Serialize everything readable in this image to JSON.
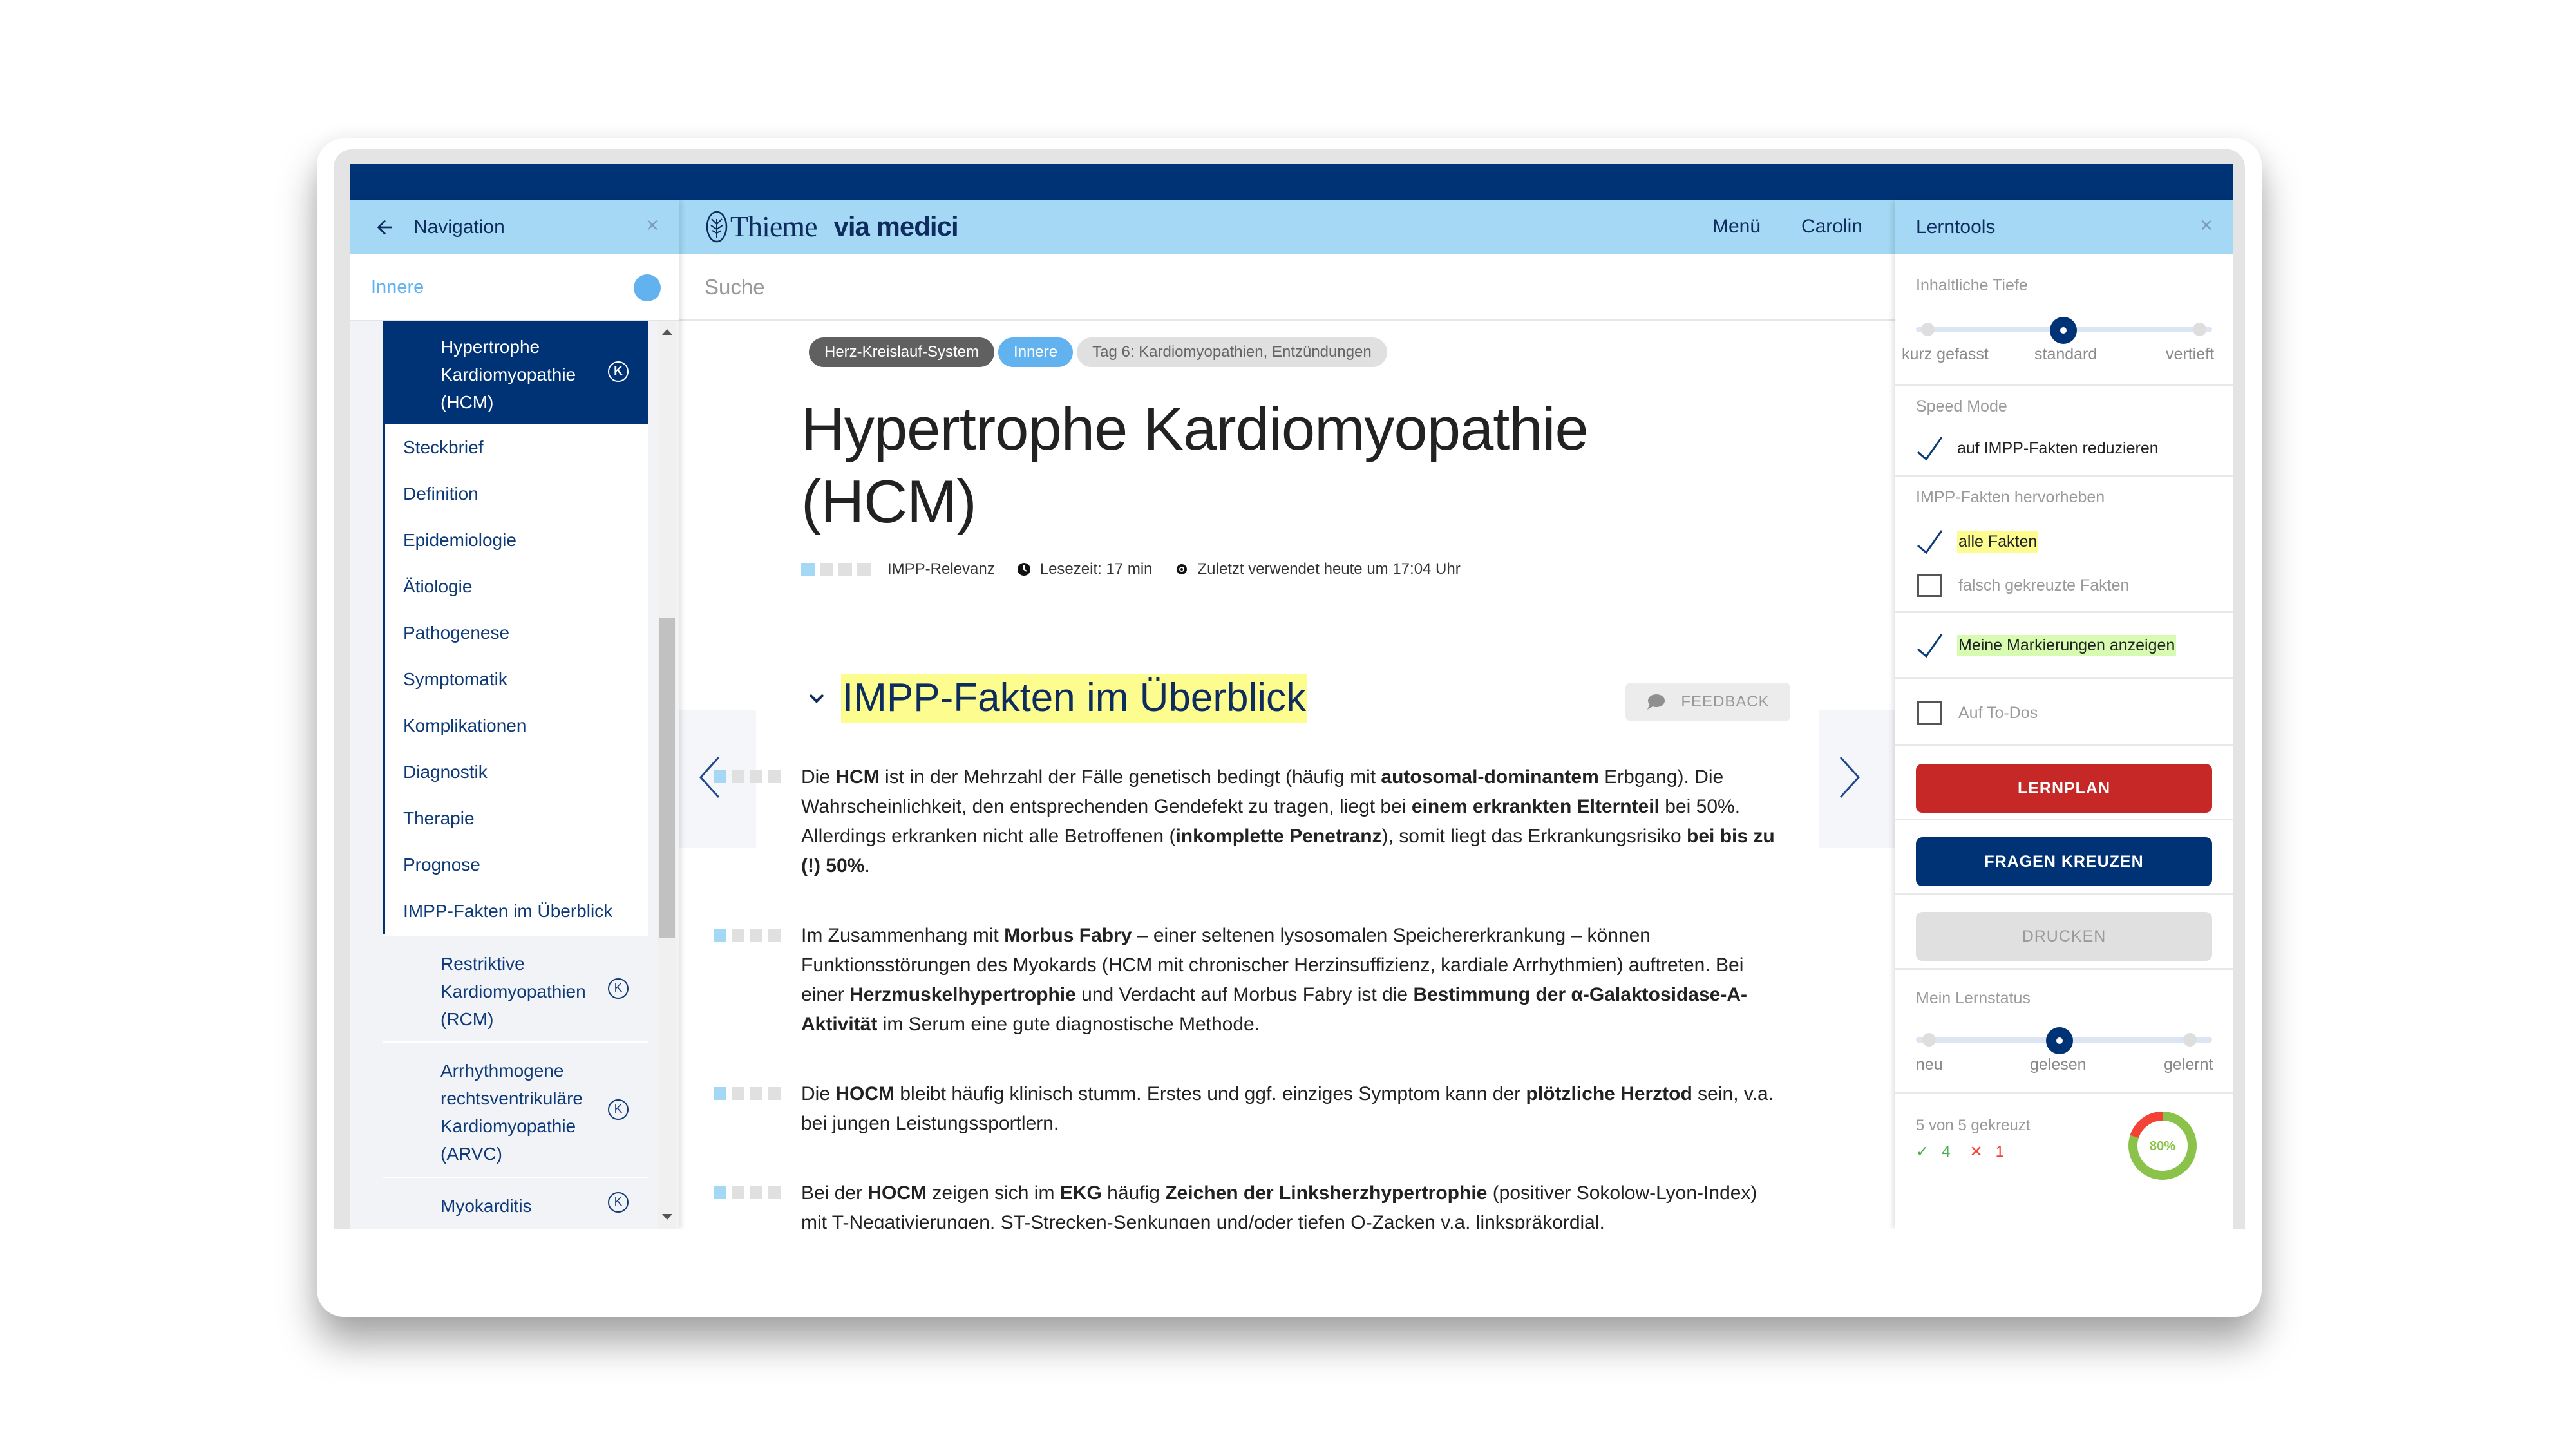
{
  "navigation": {
    "title": "Navigation",
    "filter_label": "Innere",
    "active_item": "Hypertrophe Kardiomyopathie (HCM)",
    "active_badge": "K",
    "sub_items": [
      "Steckbrief",
      "Definition",
      "Epidemiologie",
      "Ätiologie",
      "Pathogenese",
      "Symptomatik",
      "Komplikationen",
      "Diagnostik",
      "Therapie",
      "Prognose",
      "IMPP-Fakten im Überblick"
    ],
    "siblings": [
      {
        "label": "Restriktive Kardiomyopathien (RCM)",
        "badge": "K"
      },
      {
        "label": "Arrhythmogene rechtsventrikuläre Kardiomyopathie (ARVC)",
        "badge": "K"
      },
      {
        "label": "Myokarditis",
        "badge": "K"
      }
    ]
  },
  "header": {
    "brand_thieme": "Thieme",
    "brand_via": "via medici",
    "menu_label": "Menü",
    "user_label": "Carolin",
    "search_placeholder": "Suche"
  },
  "article": {
    "tags": [
      "Herz-Kreislauf-System",
      "Innere",
      "Tag 6: Kardiomyopathien, Entzündungen"
    ],
    "title": "Hypertrophe Kardiomyopathie (HCM)",
    "impp_relevance_label": "IMPP-Relevanz",
    "impp_relevance_level": "1 of 4",
    "reading_time": "Lesezeit: 17 min",
    "last_used": "Zuletzt verwendet heute um 17:04 Uhr",
    "section_title": "IMPP-Fakten im Überblick",
    "feedback_label": "FEEDBACK",
    "facts": [
      {
        "relevance": "1 of 4",
        "segments": [
          {
            "t": "Die "
          },
          {
            "t": "HCM",
            "b": true
          },
          {
            "t": " ist in der Mehrzahl der Fälle genetisch bedingt (häufig mit "
          },
          {
            "t": "autosomal-dominantem",
            "b": true
          },
          {
            "t": " Erbgang). Die Wahrscheinlichkeit, den entsprechenden Gendefekt zu tragen, liegt bei "
          },
          {
            "t": "einem erkrankten Elternteil",
            "b": true
          },
          {
            "t": " bei 50%. Allerdings erkranken nicht alle Betroffenen ("
          },
          {
            "t": "inkomplette Penetranz",
            "b": true
          },
          {
            "t": "), somit liegt das Erkrankungsrisiko "
          },
          {
            "t": "bei bis zu (!) 50%",
            "b": true
          },
          {
            "t": "."
          }
        ]
      },
      {
        "relevance": "1 of 4",
        "segments": [
          {
            "t": "Im Zusammenhang mit "
          },
          {
            "t": "Morbus Fabry",
            "b": true
          },
          {
            "t": " – einer seltenen lysosomalen Speichererkrankung – können Funktionsstörungen des Myokards (HCM mit chronischer Herzinsuffizienz, kardiale Arrhythmien) auftreten. Bei einer "
          },
          {
            "t": "Herzmuskelhypertrophie",
            "b": true
          },
          {
            "t": " und Verdacht auf Morbus Fabry ist die "
          },
          {
            "t": "Bestimmung der α-Galaktosidase-A-Aktivität",
            "b": true
          },
          {
            "t": " im Serum eine gute diagnostische Methode."
          }
        ]
      },
      {
        "relevance": "1 of 4",
        "segments": [
          {
            "t": "Die "
          },
          {
            "t": "HOCM",
            "b": true
          },
          {
            "t": " bleibt häufig klinisch stumm. Erstes und ggf. einziges Symptom kann der "
          },
          {
            "t": "plötzliche Herztod",
            "b": true
          },
          {
            "t": " sein, v.a. bei jungen Leistungssportlern."
          }
        ]
      },
      {
        "relevance": "1 of 4",
        "segments": [
          {
            "t": "Bei der "
          },
          {
            "t": "HOCM",
            "b": true
          },
          {
            "t": " zeigen sich im "
          },
          {
            "t": "EKG",
            "b": true
          },
          {
            "t": " häufig "
          },
          {
            "t": "Zeichen der Linksherzhypertrophie",
            "b": true
          },
          {
            "t": " (positiver Sokolow-Lyon-Index) mit T-Negativierungen, ST-Strecken-Senkungen und/oder tiefen Q-Zacken v.a. linkspräkordial."
          }
        ]
      }
    ]
  },
  "lerntools": {
    "title": "Lerntools",
    "depth": {
      "label": "Inhaltliche Tiefe",
      "options": [
        "kurz gefasst",
        "standard",
        "vertieft"
      ],
      "selected": "standard"
    },
    "speed_mode": {
      "label": "Speed Mode",
      "option": "auf IMPP-Fakten reduzieren",
      "checked": true
    },
    "highlight": {
      "label": "IMPP-Fakten hervorheben",
      "options": [
        {
          "label": "alle Fakten",
          "checked": true
        },
        {
          "label": "falsch gekreuzte Fakten",
          "checked": false
        }
      ]
    },
    "markings": {
      "label": "Meine Markierungen anzeigen",
      "checked": true
    },
    "todos": {
      "label": "Auf To-Dos",
      "checked": false
    },
    "buttons": {
      "lernplan": "LERNPLAN",
      "fragen": "FRAGEN KREUZEN",
      "drucken": "DRUCKEN"
    },
    "status": {
      "label": "Mein Lernstatus",
      "options": [
        "neu",
        "gelesen",
        "gelernt"
      ],
      "selected": "gelesen"
    },
    "score": {
      "summary": "5 von 5 gekreuzt",
      "correct": "4",
      "wrong": "1",
      "percent_label": "80%",
      "percent": 80
    }
  },
  "colors": {
    "navy": "#003375",
    "light_blue": "#a4d8f4",
    "accent_blue": "#62b2f0",
    "red": "#c62828",
    "green": "#8bc34a",
    "highlight_yellow": "#fcfc8f",
    "highlight_green": "#d7fbb0"
  }
}
